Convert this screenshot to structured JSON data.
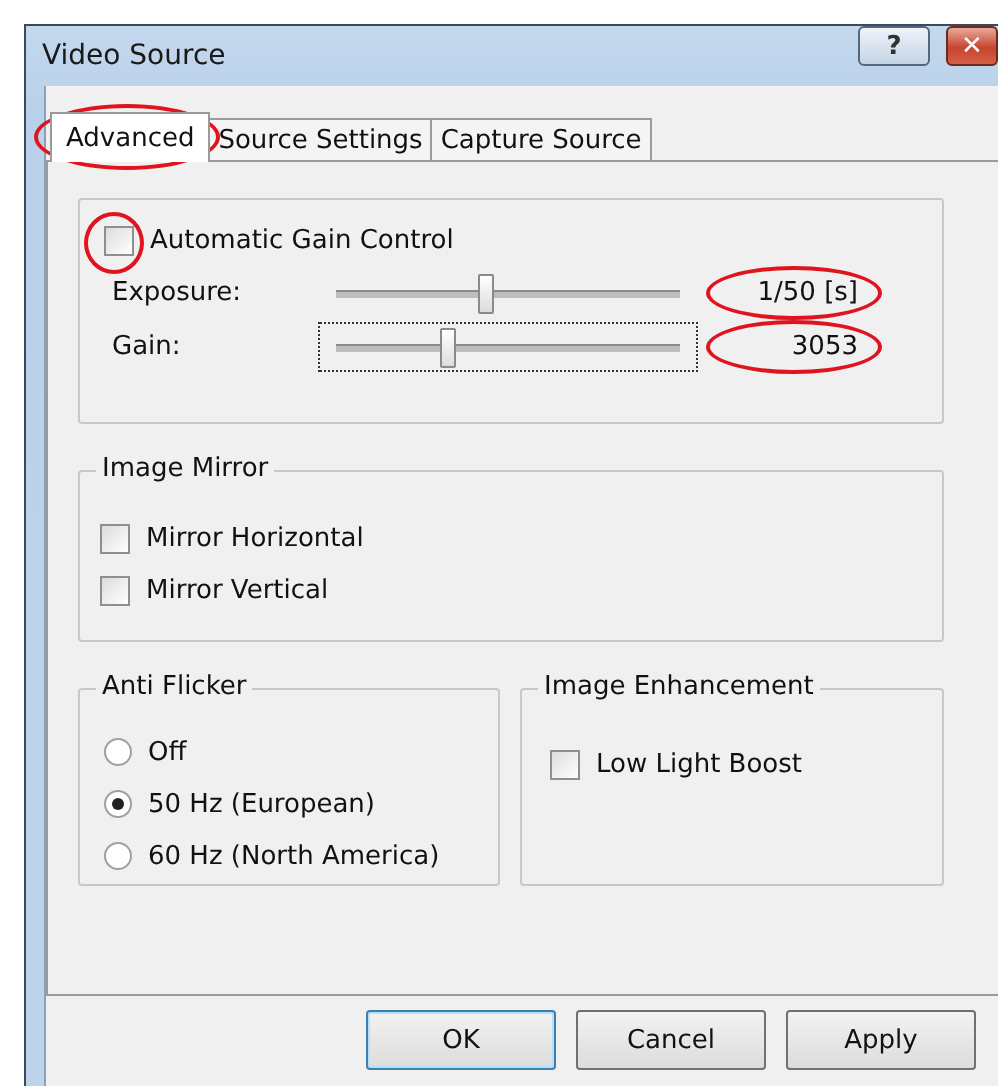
{
  "window": {
    "title": "Video Source",
    "buttons": [
      {
        "kind": "help",
        "label": "?"
      },
      {
        "kind": "close",
        "label": "✕"
      }
    ]
  },
  "tabs": [
    {
      "label": "Advanced",
      "selected": true,
      "circled": true
    },
    {
      "label": "Source Settings",
      "selected": false,
      "circled": false
    },
    {
      "label": "Capture Source",
      "selected": false,
      "circled": false
    }
  ],
  "exposure_group": {
    "auto_gain": {
      "label": "Automatic Gain Control",
      "checked": false,
      "circled": true
    },
    "sliders": [
      {
        "label": "Exposure:",
        "level": 0.43,
        "reading": "1/50 [s]",
        "focused": false,
        "circled": true
      },
      {
        "label": "Gain:",
        "level": 0.32,
        "reading": "3053",
        "focused": true,
        "circled": true
      }
    ]
  },
  "image_mirror": {
    "title": "Image Mirror",
    "options": [
      {
        "label": "Mirror Horizontal",
        "checked": false
      },
      {
        "label": "Mirror Vertical",
        "checked": false
      }
    ]
  },
  "anti_flicker": {
    "title": "Anti Flicker",
    "options": [
      {
        "label": "Off",
        "selected": false
      },
      {
        "label": "50 Hz (European)",
        "selected": true
      },
      {
        "label": "60 Hz (North America)",
        "selected": false
      }
    ]
  },
  "image_enhancement": {
    "title": "Image Enhancement",
    "options": [
      {
        "label": "Low Light Boost",
        "checked": false
      }
    ]
  },
  "buttons": [
    {
      "label": "OK",
      "default": true
    },
    {
      "label": "Cancel",
      "default": false
    },
    {
      "label": "Apply",
      "default": false
    }
  ]
}
